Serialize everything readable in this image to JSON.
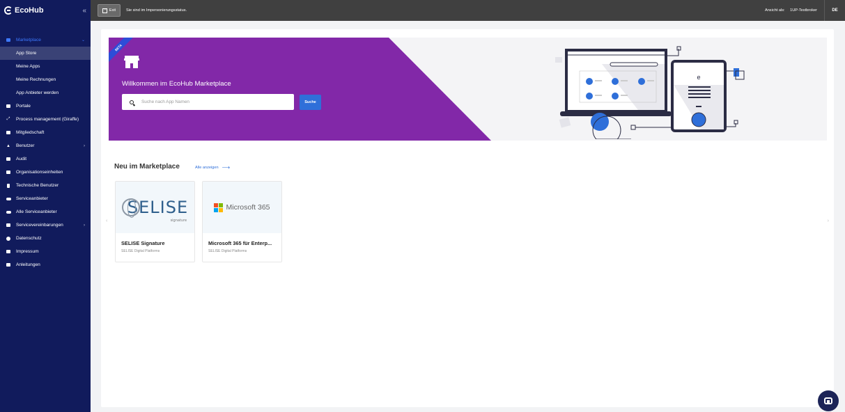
{
  "app": {
    "name": "EcoHub",
    "collapse_glyph": "«"
  },
  "topbar": {
    "exit_label": "Exit",
    "impersonation_text": "Sie sind im Impersonierungsstatus.",
    "view_as_label": "Ansicht als:",
    "view_as_value": "1UP-Testbroker",
    "language": "DE"
  },
  "sidebar": {
    "items": [
      {
        "label": "Marketplace",
        "icon": "store-icon"
      },
      {
        "label": "App Store"
      },
      {
        "label": "Meine Apps"
      },
      {
        "label": "Meine Rechnungen"
      },
      {
        "label": "App Anbieter werden"
      },
      {
        "label": "Portale",
        "icon": "portal-icon"
      },
      {
        "label": "Process management (Giraffe)",
        "icon": "process-icon"
      },
      {
        "label": "Mitgliedschaft",
        "icon": "membership-icon"
      },
      {
        "label": "Benutzer",
        "icon": "user-icon"
      },
      {
        "label": "Audit",
        "icon": "audit-icon"
      },
      {
        "label": "Organisationseinheiten",
        "icon": "org-icon"
      },
      {
        "label": "Technische Benutzer",
        "icon": "tech-user-icon"
      },
      {
        "label": "Serviceanbieter",
        "icon": "service-icon"
      },
      {
        "label": "Alle Serviceanbieter",
        "icon": "service-all-icon"
      },
      {
        "label": "Servicevereinbarungen",
        "icon": "agreement-icon"
      },
      {
        "label": "Datenschutz",
        "icon": "privacy-icon"
      },
      {
        "label": "Impressum",
        "icon": "imprint-icon"
      },
      {
        "label": "Anleitungen",
        "icon": "guide-icon"
      }
    ]
  },
  "hero": {
    "badge": "BETA",
    "title": "Willkommen im EcoHub Marketplace",
    "search_placeholder": "Suche nach App Namen",
    "search_button": "Suche"
  },
  "section": {
    "title": "Neu im Marketplace",
    "see_all": "Alle anzeigen",
    "arrow": "⟶"
  },
  "apps": [
    {
      "title": "SELISE Signature",
      "publisher": "SELISE Digital Platforms",
      "logo_text": "SELISE",
      "logo_sub": "signature"
    },
    {
      "title": "Microsoft 365 für Enterp...",
      "publisher": "SELISE Digital Platforms",
      "logo_text": "Microsoft 365"
    }
  ],
  "carousel": {
    "prev": "‹",
    "next": "›"
  },
  "colors": {
    "sidebar_bg": "#111b5c",
    "hero_purple": "#8228a8",
    "accent_blue": "#2f6fd9",
    "topbar_bg": "#404040"
  }
}
